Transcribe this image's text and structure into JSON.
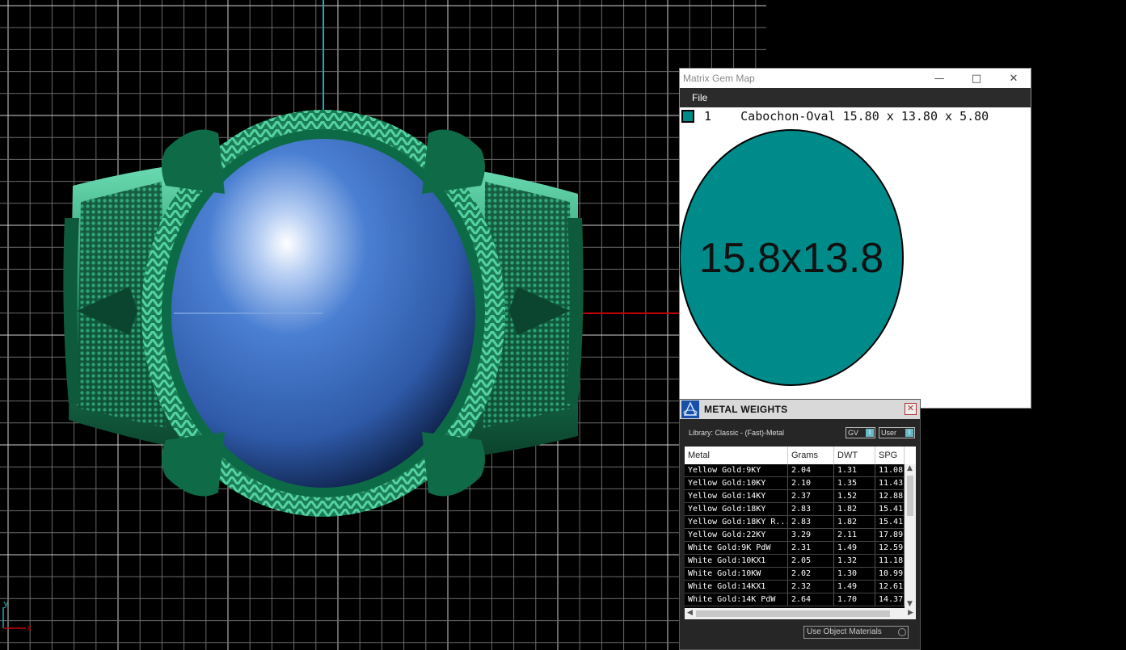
{
  "viewport": {
    "axis_y_label": "y",
    "axis_x_label": "x",
    "colors": {
      "background": "#000000",
      "grid": "#8a8a8a",
      "ring_metal": "#1e8a5f",
      "gem": "#3d6fc4",
      "axis_red": "#c00000",
      "axis_cyan": "#2aa6b8"
    }
  },
  "gem_map": {
    "title": "Matrix Gem Map",
    "menu_file": "File",
    "gem_index": "1",
    "gem_description": "Cabochon-Oval 15.80 x 13.80 x 5.80",
    "gem_size_label": "15.8x13.8",
    "gem_color": "#008b8b"
  },
  "metal_weights": {
    "title": "METAL WEIGHTS",
    "library": "Library: Classic - (Fast)-Metal",
    "toggle_gv": "GV",
    "toggle_user": "User",
    "columns": [
      "Metal",
      "Grams",
      "DWT",
      "SPG"
    ],
    "rows": [
      [
        "Yellow Gold:9KY",
        "2.04",
        "1.31",
        "11.08"
      ],
      [
        "Yellow Gold:10KY",
        "2.10",
        "1.35",
        "11.43"
      ],
      [
        "Yellow Gold:14KY",
        "2.37",
        "1.52",
        "12.88"
      ],
      [
        "Yellow Gold:18KY",
        "2.83",
        "1.82",
        "15.41"
      ],
      [
        "Yellow Gold:18KY R...",
        "2.83",
        "1.82",
        "15.41"
      ],
      [
        "Yellow Gold:22KY",
        "3.29",
        "2.11",
        "17.89"
      ],
      [
        "White Gold:9K PdW",
        "2.31",
        "1.49",
        "12.59"
      ],
      [
        "White Gold:10KX1",
        "2.05",
        "1.32",
        "11.18"
      ],
      [
        "White Gold:10KW",
        "2.02",
        "1.30",
        "10.99"
      ],
      [
        "White Gold:14KX1",
        "2.32",
        "1.49",
        "12.61"
      ],
      [
        "White Gold:14K PdW",
        "2.64",
        "1.70",
        "14.37"
      ]
    ],
    "use_object_materials": "Use Object Materials"
  }
}
